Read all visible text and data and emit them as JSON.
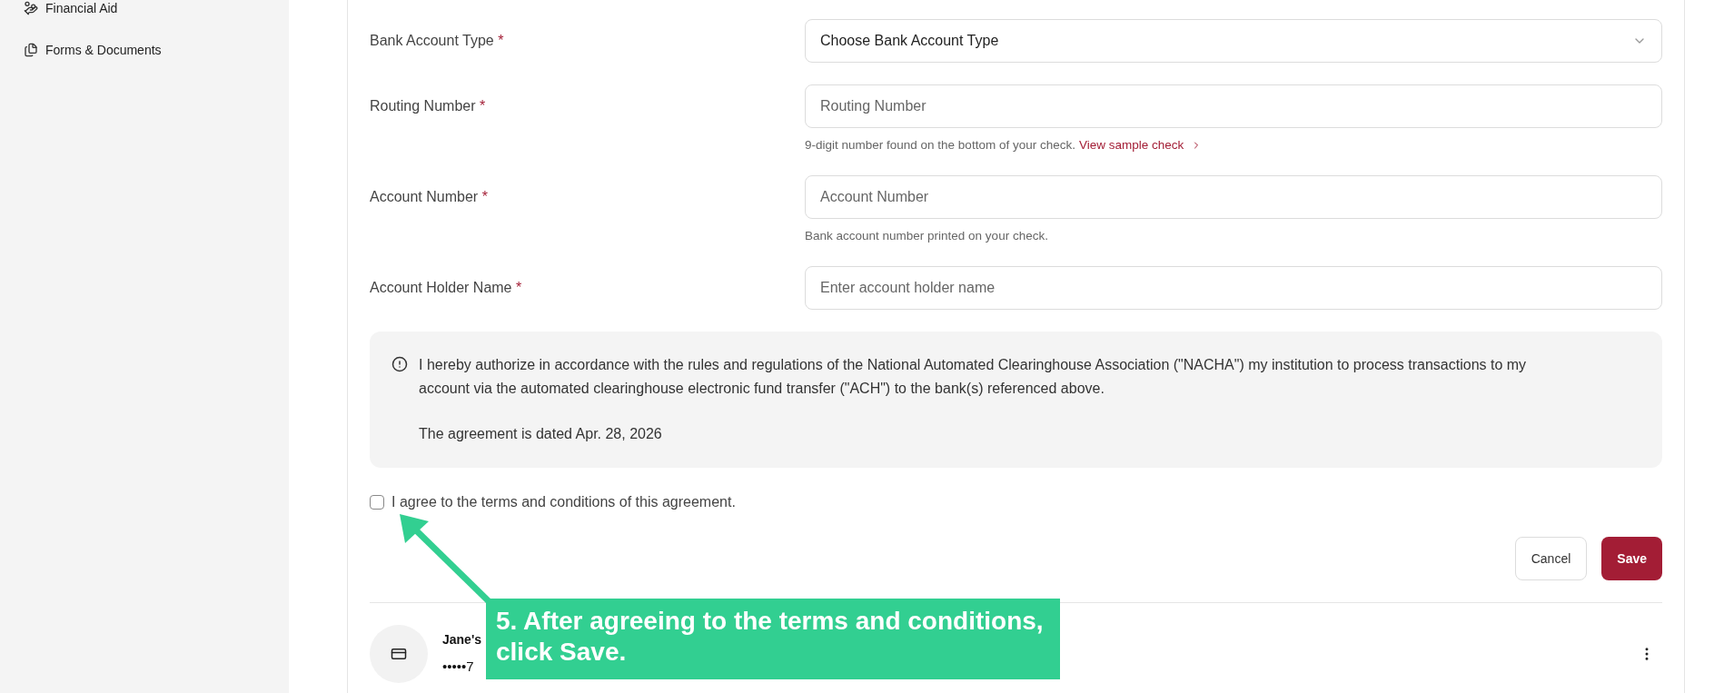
{
  "sidebar": {
    "items": [
      {
        "kind": "aid",
        "label": "Financial Aid"
      },
      {
        "kind": "documents",
        "label": "Forms & Documents"
      }
    ]
  },
  "form": {
    "fields": [
      {
        "kind": "select",
        "label": "Bank Account Type",
        "marker": "*",
        "placeholder": "Choose Bank Account Type"
      },
      {
        "kind": "input",
        "label": "Routing Number",
        "marker": "*",
        "placeholder": "Routing Number",
        "hint": "9-digit number found on the bottom of your check.",
        "link": "View sample check"
      },
      {
        "kind": "input",
        "label": "Account Number",
        "marker": "*",
        "placeholder": "Account Number",
        "hint": "Bank account number printed on your check."
      },
      {
        "kind": "input",
        "label": "Account Holder Name",
        "marker": "*",
        "placeholder": "Enter account holder name"
      }
    ],
    "notice": {
      "paragraphs": [
        "I hereby authorize in accordance with the rules and regulations of the National Automated Clearinghouse Association (\"NACHA\") my institution to process transactions to my account via the automated clearinghouse electronic fund transfer (\"ACH\") to the bank(s) referenced above.",
        "The agreement is dated Apr. 28, 2026"
      ]
    },
    "agreement": {
      "label": "I agree to the terms and conditions of this agreement.",
      "checked": false
    },
    "buttons": [
      {
        "kind": "secondary",
        "label": "Cancel"
      },
      {
        "kind": "primary",
        "label": "Save"
      }
    ]
  },
  "account_card": {
    "title": "Jane's",
    "number": "•••••7"
  },
  "annotation": {
    "text": "5. After agreeing to the terms and conditions, click Save."
  }
}
